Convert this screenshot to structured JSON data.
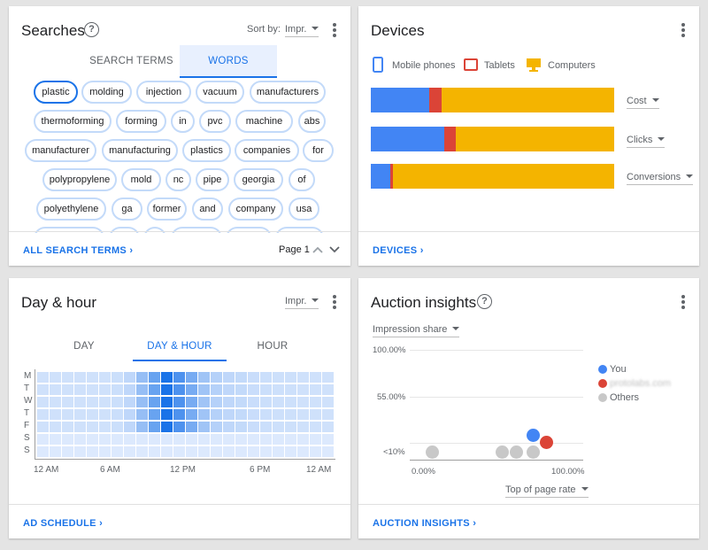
{
  "searches": {
    "title": "Searches",
    "help": "?",
    "sort_label": "Sort by:",
    "sort_value": "Impr.",
    "tabs": [
      {
        "label": "SEARCH TERMS",
        "active": false
      },
      {
        "label": "WORDS",
        "active": true
      }
    ],
    "chips": [
      "plastic",
      "molding",
      "injection",
      "vacuum",
      "manufacturers",
      "thermoforming",
      "forming",
      "in",
      "pvc",
      "machine",
      "abs",
      "manufacturer",
      "manufacturing",
      "plastics",
      "companies",
      "for",
      "polypropylene",
      "mold",
      "nc",
      "pipe",
      "georgia",
      "of",
      "polyethylene",
      "ga",
      "former",
      "and",
      "company",
      "usa"
    ],
    "page_label": "Page 1",
    "footer_link": "ALL SEARCH TERMS"
  },
  "devices": {
    "title": "Devices",
    "legend": [
      {
        "label": "Mobile phones",
        "color": "#4285f4",
        "icon": "phone-icon"
      },
      {
        "label": "Tablets",
        "color": "#db4437",
        "icon": "tablet-icon"
      },
      {
        "label": "Computers",
        "color": "#f4b400",
        "icon": "computer-icon"
      }
    ],
    "rows": [
      {
        "metric": "Cost",
        "mobile": 24,
        "tablet": 5,
        "computer": 71
      },
      {
        "metric": "Clicks",
        "mobile": 30,
        "tablet": 5,
        "computer": 65
      },
      {
        "metric": "Conversions",
        "mobile": 8,
        "tablet": 1,
        "computer": 91
      }
    ],
    "footer_link": "DEVICES"
  },
  "dayhour": {
    "title": "Day & hour",
    "metric": "Impr.",
    "tabs": [
      {
        "label": "DAY",
        "active": false
      },
      {
        "label": "DAY & HOUR",
        "active": true
      },
      {
        "label": "HOUR",
        "active": false
      }
    ],
    "days": [
      "M",
      "T",
      "W",
      "T",
      "F",
      "S",
      "S"
    ],
    "hour_labels": [
      "12 AM",
      "6 AM",
      "12 PM",
      "6 PM",
      "12 AM"
    ],
    "footer_link": "AD SCHEDULE"
  },
  "auction": {
    "title": "Auction insights",
    "help": "?",
    "metric": "Impression share",
    "y_labels": [
      "100.00%",
      "55.00%",
      "<10%"
    ],
    "x_labels": [
      "0.00%",
      "100.00%"
    ],
    "x_metric": "Top of page rate",
    "legend": [
      {
        "label": "You",
        "color": "#4285f4"
      },
      {
        "label": "protolabs.com",
        "color": "#db4437"
      },
      {
        "label": "Others",
        "color": "#c8c8c8"
      }
    ],
    "footer_link": "AUCTION INSIGHTS"
  }
}
